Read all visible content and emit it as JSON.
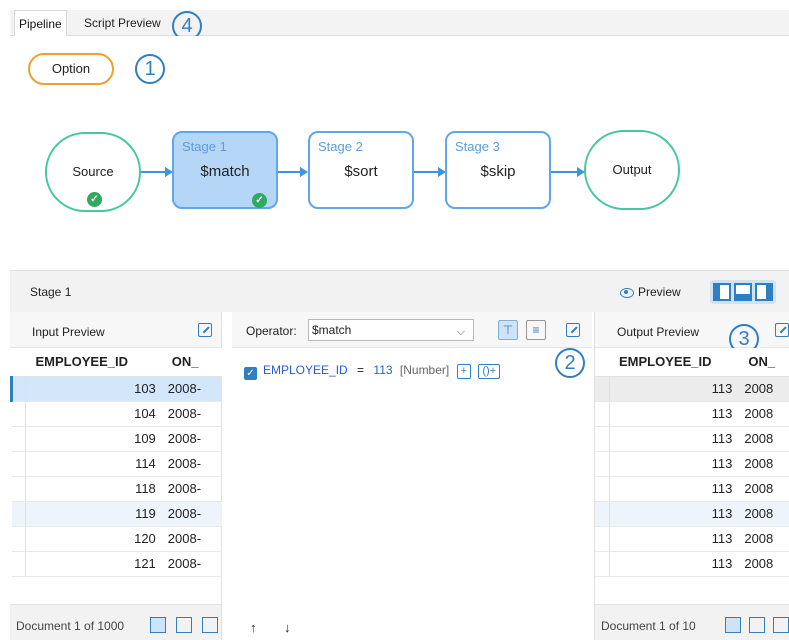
{
  "tabs": [
    {
      "label": "Pipeline",
      "active": true
    },
    {
      "label": "Script Preview",
      "active": false
    }
  ],
  "callouts": [
    "1",
    "2",
    "3",
    "4"
  ],
  "pipeline": {
    "option_label": "Option",
    "source_label": "Source",
    "output_label": "Output",
    "stages": [
      {
        "caption": "Stage 1",
        "operator": "$match",
        "selected": true
      },
      {
        "caption": "Stage 2",
        "operator": "$sort",
        "selected": false
      },
      {
        "caption": "Stage 3",
        "operator": "$skip",
        "selected": false
      }
    ]
  },
  "stage_bar": {
    "title": "Stage 1",
    "preview_label": "Preview"
  },
  "input_preview": {
    "title": "Input Preview",
    "columns": [
      "EMPLOYEE_ID",
      "ON_"
    ],
    "rows": [
      [
        "103",
        "2008-"
      ],
      [
        "104",
        "2008-"
      ],
      [
        "109",
        "2008-"
      ],
      [
        "114",
        "2008-"
      ],
      [
        "118",
        "2008-"
      ],
      [
        "119",
        "2008-"
      ],
      [
        "120",
        "2008-"
      ],
      [
        "121",
        "2008-"
      ]
    ],
    "footer": "Document 1 of 1000"
  },
  "operator": {
    "label": "Operator:",
    "value": "$match",
    "condition": {
      "field": "EMPLOYEE_ID",
      "op": "=",
      "value": "113",
      "type": "[Number]"
    },
    "add_label": "+",
    "add_group_label": "()+",
    "move_up": "↑",
    "move_down": "↓"
  },
  "output_preview": {
    "title": "Output Preview",
    "columns": [
      "EMPLOYEE_ID",
      "ON_"
    ],
    "rows": [
      [
        "113",
        "2008"
      ],
      [
        "113",
        "2008"
      ],
      [
        "113",
        "2008"
      ],
      [
        "113",
        "2008"
      ],
      [
        "113",
        "2008"
      ],
      [
        "113",
        "2008"
      ],
      [
        "113",
        "2008"
      ],
      [
        "113",
        "2008"
      ]
    ],
    "footer": "Document 1 of 10"
  }
}
